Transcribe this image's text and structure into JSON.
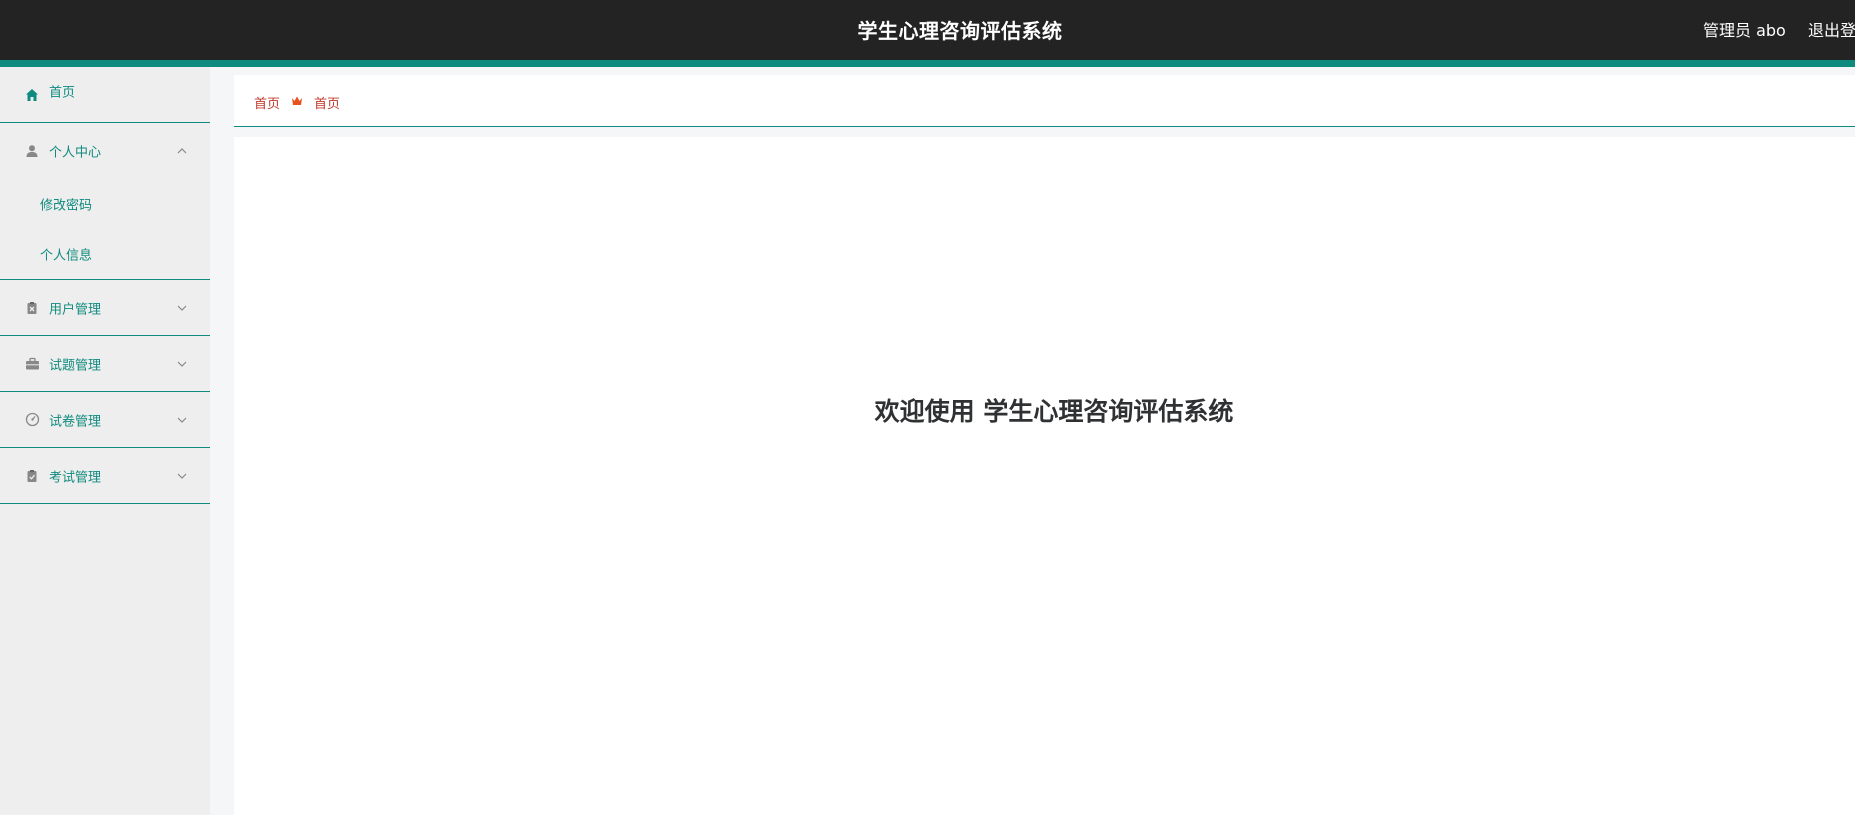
{
  "header": {
    "title": "学生心理咨询评估系统",
    "user_label": "管理员 abo",
    "logout_label": "退出登"
  },
  "sidebar": {
    "items": [
      {
        "label": "首页",
        "icon": "home-icon"
      },
      {
        "label": "个人中心",
        "icon": "user-icon",
        "expanded": true,
        "children": [
          {
            "label": "修改密码"
          },
          {
            "label": "个人信息"
          }
        ]
      },
      {
        "label": "用户管理",
        "icon": "clipboard-x-icon"
      },
      {
        "label": "试题管理",
        "icon": "briefcase-icon"
      },
      {
        "label": "试卷管理",
        "icon": "gauge-icon"
      },
      {
        "label": "考试管理",
        "icon": "clipboard-check-icon"
      }
    ]
  },
  "breadcrumb": {
    "root": "首页",
    "current": "首页"
  },
  "main": {
    "welcome": "欢迎使用 学生心理咨询评估系统"
  },
  "colors": {
    "accent": "#0f8a7e",
    "topbar": "#232323",
    "breadcrumb_text": "#c0392b"
  }
}
